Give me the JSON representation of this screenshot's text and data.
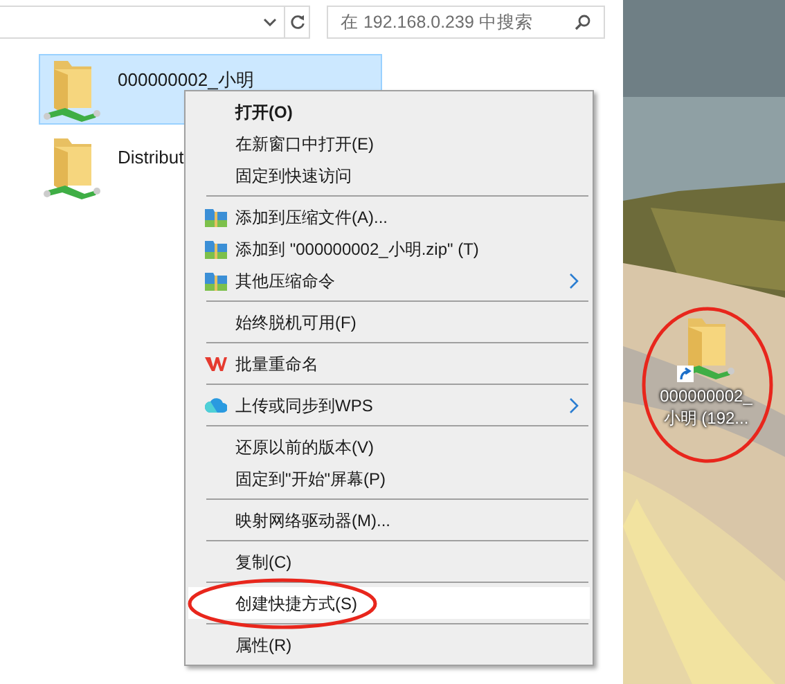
{
  "search": {
    "placeholder": "在 192.168.0.239 中搜索"
  },
  "files": [
    {
      "name": "000000002_小明",
      "selected": true
    },
    {
      "name": "Distribut",
      "selected": false
    }
  ],
  "context_menu": [
    {
      "kind": "default",
      "label": "打开(O)",
      "submenu": false,
      "highlighted": false
    },
    {
      "kind": "plain",
      "label": "在新窗口中打开(E)",
      "submenu": false,
      "highlighted": false
    },
    {
      "kind": "plain",
      "label": "固定到快速访问",
      "submenu": false,
      "highlighted": false
    },
    {
      "kind": "separator"
    },
    {
      "kind": "archive",
      "label": "添加到压缩文件(A)...",
      "submenu": false,
      "highlighted": false
    },
    {
      "kind": "archive",
      "label": "添加到 \"000000002_小明.zip\" (T)",
      "submenu": false,
      "highlighted": false
    },
    {
      "kind": "archive",
      "label": "其他压缩命令",
      "submenu": true,
      "highlighted": false
    },
    {
      "kind": "separator"
    },
    {
      "kind": "plain",
      "label": "始终脱机可用(F)",
      "submenu": false,
      "highlighted": false
    },
    {
      "kind": "separator"
    },
    {
      "kind": "wps",
      "label": "批量重命名",
      "submenu": false,
      "highlighted": false
    },
    {
      "kind": "separator"
    },
    {
      "kind": "cloud",
      "label": "上传或同步到WPS",
      "submenu": true,
      "highlighted": false
    },
    {
      "kind": "separator"
    },
    {
      "kind": "plain",
      "label": "还原以前的版本(V)",
      "submenu": false,
      "highlighted": false
    },
    {
      "kind": "plain",
      "label": "固定到\"开始\"屏幕(P)",
      "submenu": false,
      "highlighted": false
    },
    {
      "kind": "separator"
    },
    {
      "kind": "plain",
      "label": "映射网络驱动器(M)...",
      "submenu": false,
      "highlighted": false
    },
    {
      "kind": "separator"
    },
    {
      "kind": "plain",
      "label": "复制(C)",
      "submenu": false,
      "highlighted": false
    },
    {
      "kind": "separator"
    },
    {
      "kind": "plain",
      "label": "创建快捷方式(S)",
      "submenu": false,
      "highlighted": true
    },
    {
      "kind": "separator"
    },
    {
      "kind": "plain",
      "label": "属性(R)",
      "submenu": false,
      "highlighted": false
    }
  ],
  "desktop_shortcut": {
    "line_1": "000000002_",
    "line_2": "小明 (192..."
  }
}
